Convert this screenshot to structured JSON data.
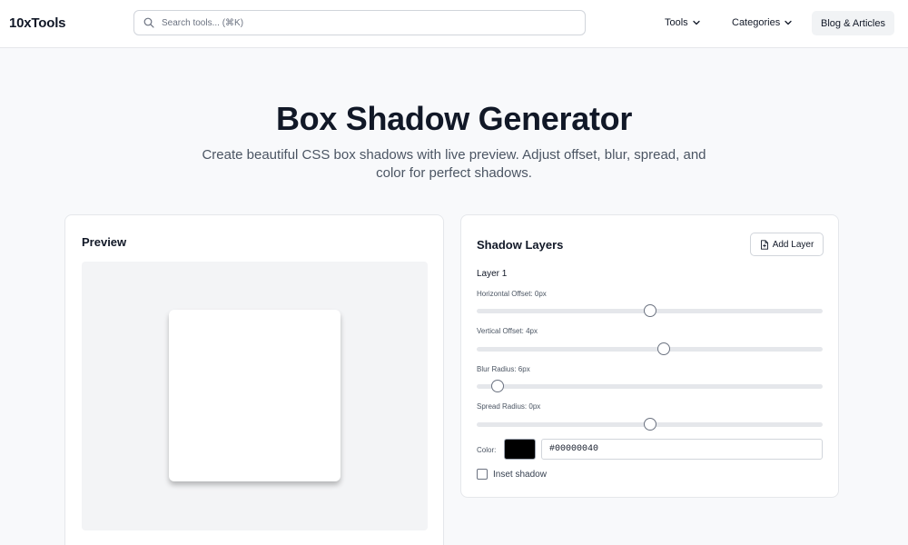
{
  "header": {
    "logo": "10xTools",
    "search_placeholder": "Search tools... (⌘K)",
    "nav": [
      {
        "label": "Tools"
      },
      {
        "label": "Categories"
      }
    ],
    "blog_label": "Blog & Articles"
  },
  "hero": {
    "title": "Box Shadow Generator",
    "subtitle": "Create beautiful CSS box shadows with live preview. Adjust offset, blur, spread, and color for perfect shadows."
  },
  "preview": {
    "title": "Preview"
  },
  "layers": {
    "title": "Shadow Layers",
    "add_label": "Add Layer",
    "layer_label": "Layer 1",
    "sliders": [
      {
        "label": "Horizontal Offset: 0px",
        "value": 0,
        "min": -50,
        "max": 50
      },
      {
        "label": "Vertical Offset: 4px",
        "value": 4,
        "min": -50,
        "max": 50
      },
      {
        "label": "Blur Radius: 6px",
        "value": 6,
        "min": 0,
        "max": 100
      },
      {
        "label": "Spread Radius: 0px",
        "value": 0,
        "min": -50,
        "max": 50
      }
    ],
    "color_label": "Color:",
    "color_value": "#00000040",
    "swatch_color": "#000000",
    "inset_label": "Inset shadow",
    "inset_checked": false
  },
  "icons": {
    "search": "search-icon",
    "chevron": "chevron-down-icon",
    "add": "document-add-icon"
  }
}
